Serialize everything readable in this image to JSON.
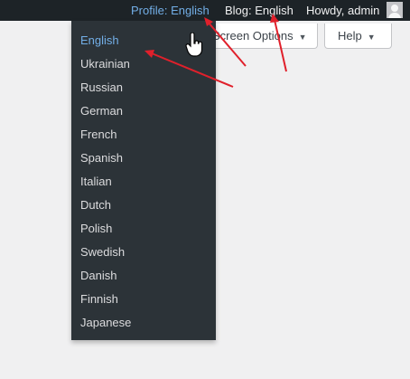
{
  "admin_bar": {
    "profile_label": "Profile: English",
    "blog_label": "Blog: English",
    "howdy_label": "Howdy, admin"
  },
  "screen_meta": {
    "screen_options_label": "Screen Options",
    "help_label": "Help"
  },
  "language_menu": {
    "selected": "English",
    "items": [
      "English",
      "Ukrainian",
      "Russian",
      "German",
      "French",
      "Spanish",
      "Italian",
      "Dutch",
      "Polish",
      "Swedish",
      "Danish",
      "Finnish",
      "Japanese"
    ]
  },
  "annotations": {
    "arrow_color": "#e0202b"
  },
  "colors": {
    "adminbar_bg": "#1d2327",
    "menu_bg": "#2c3338",
    "link_blue": "#72aee6",
    "page_bg": "#f0f0f1"
  }
}
